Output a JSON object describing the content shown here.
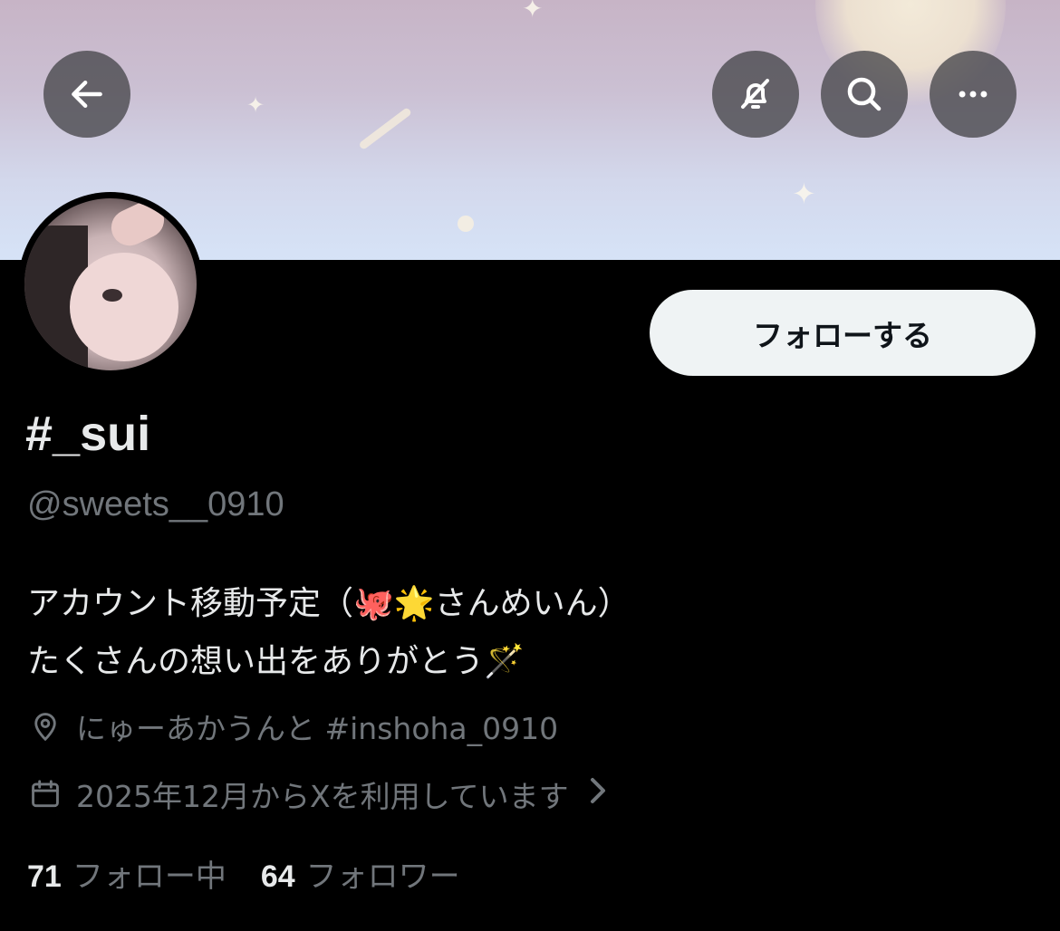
{
  "header": {
    "back_icon": "arrow-left-icon",
    "action_icons": [
      "bell-off-icon",
      "search-icon",
      "more-horizontal-icon"
    ]
  },
  "profile": {
    "follow_button_label": "フォローする",
    "display_name": "#_sui",
    "handle": "@sweets__0910",
    "bio_line_1": "アカウント移動予定（🐙🌟さんめいん）",
    "bio_line_2": "たくさんの想い出をありがとう🪄",
    "location": "にゅーあかうんと #inshoha_0910",
    "joined": "2025年12月からXを利用しています",
    "following_count": "71",
    "following_label": "フォロー中",
    "followers_count": "64",
    "followers_label": "フォロワー"
  },
  "colors": {
    "background": "#000000",
    "text_primary": "#e7e9ea",
    "text_secondary": "#71767b",
    "follow_button_bg": "#eff3f4"
  }
}
